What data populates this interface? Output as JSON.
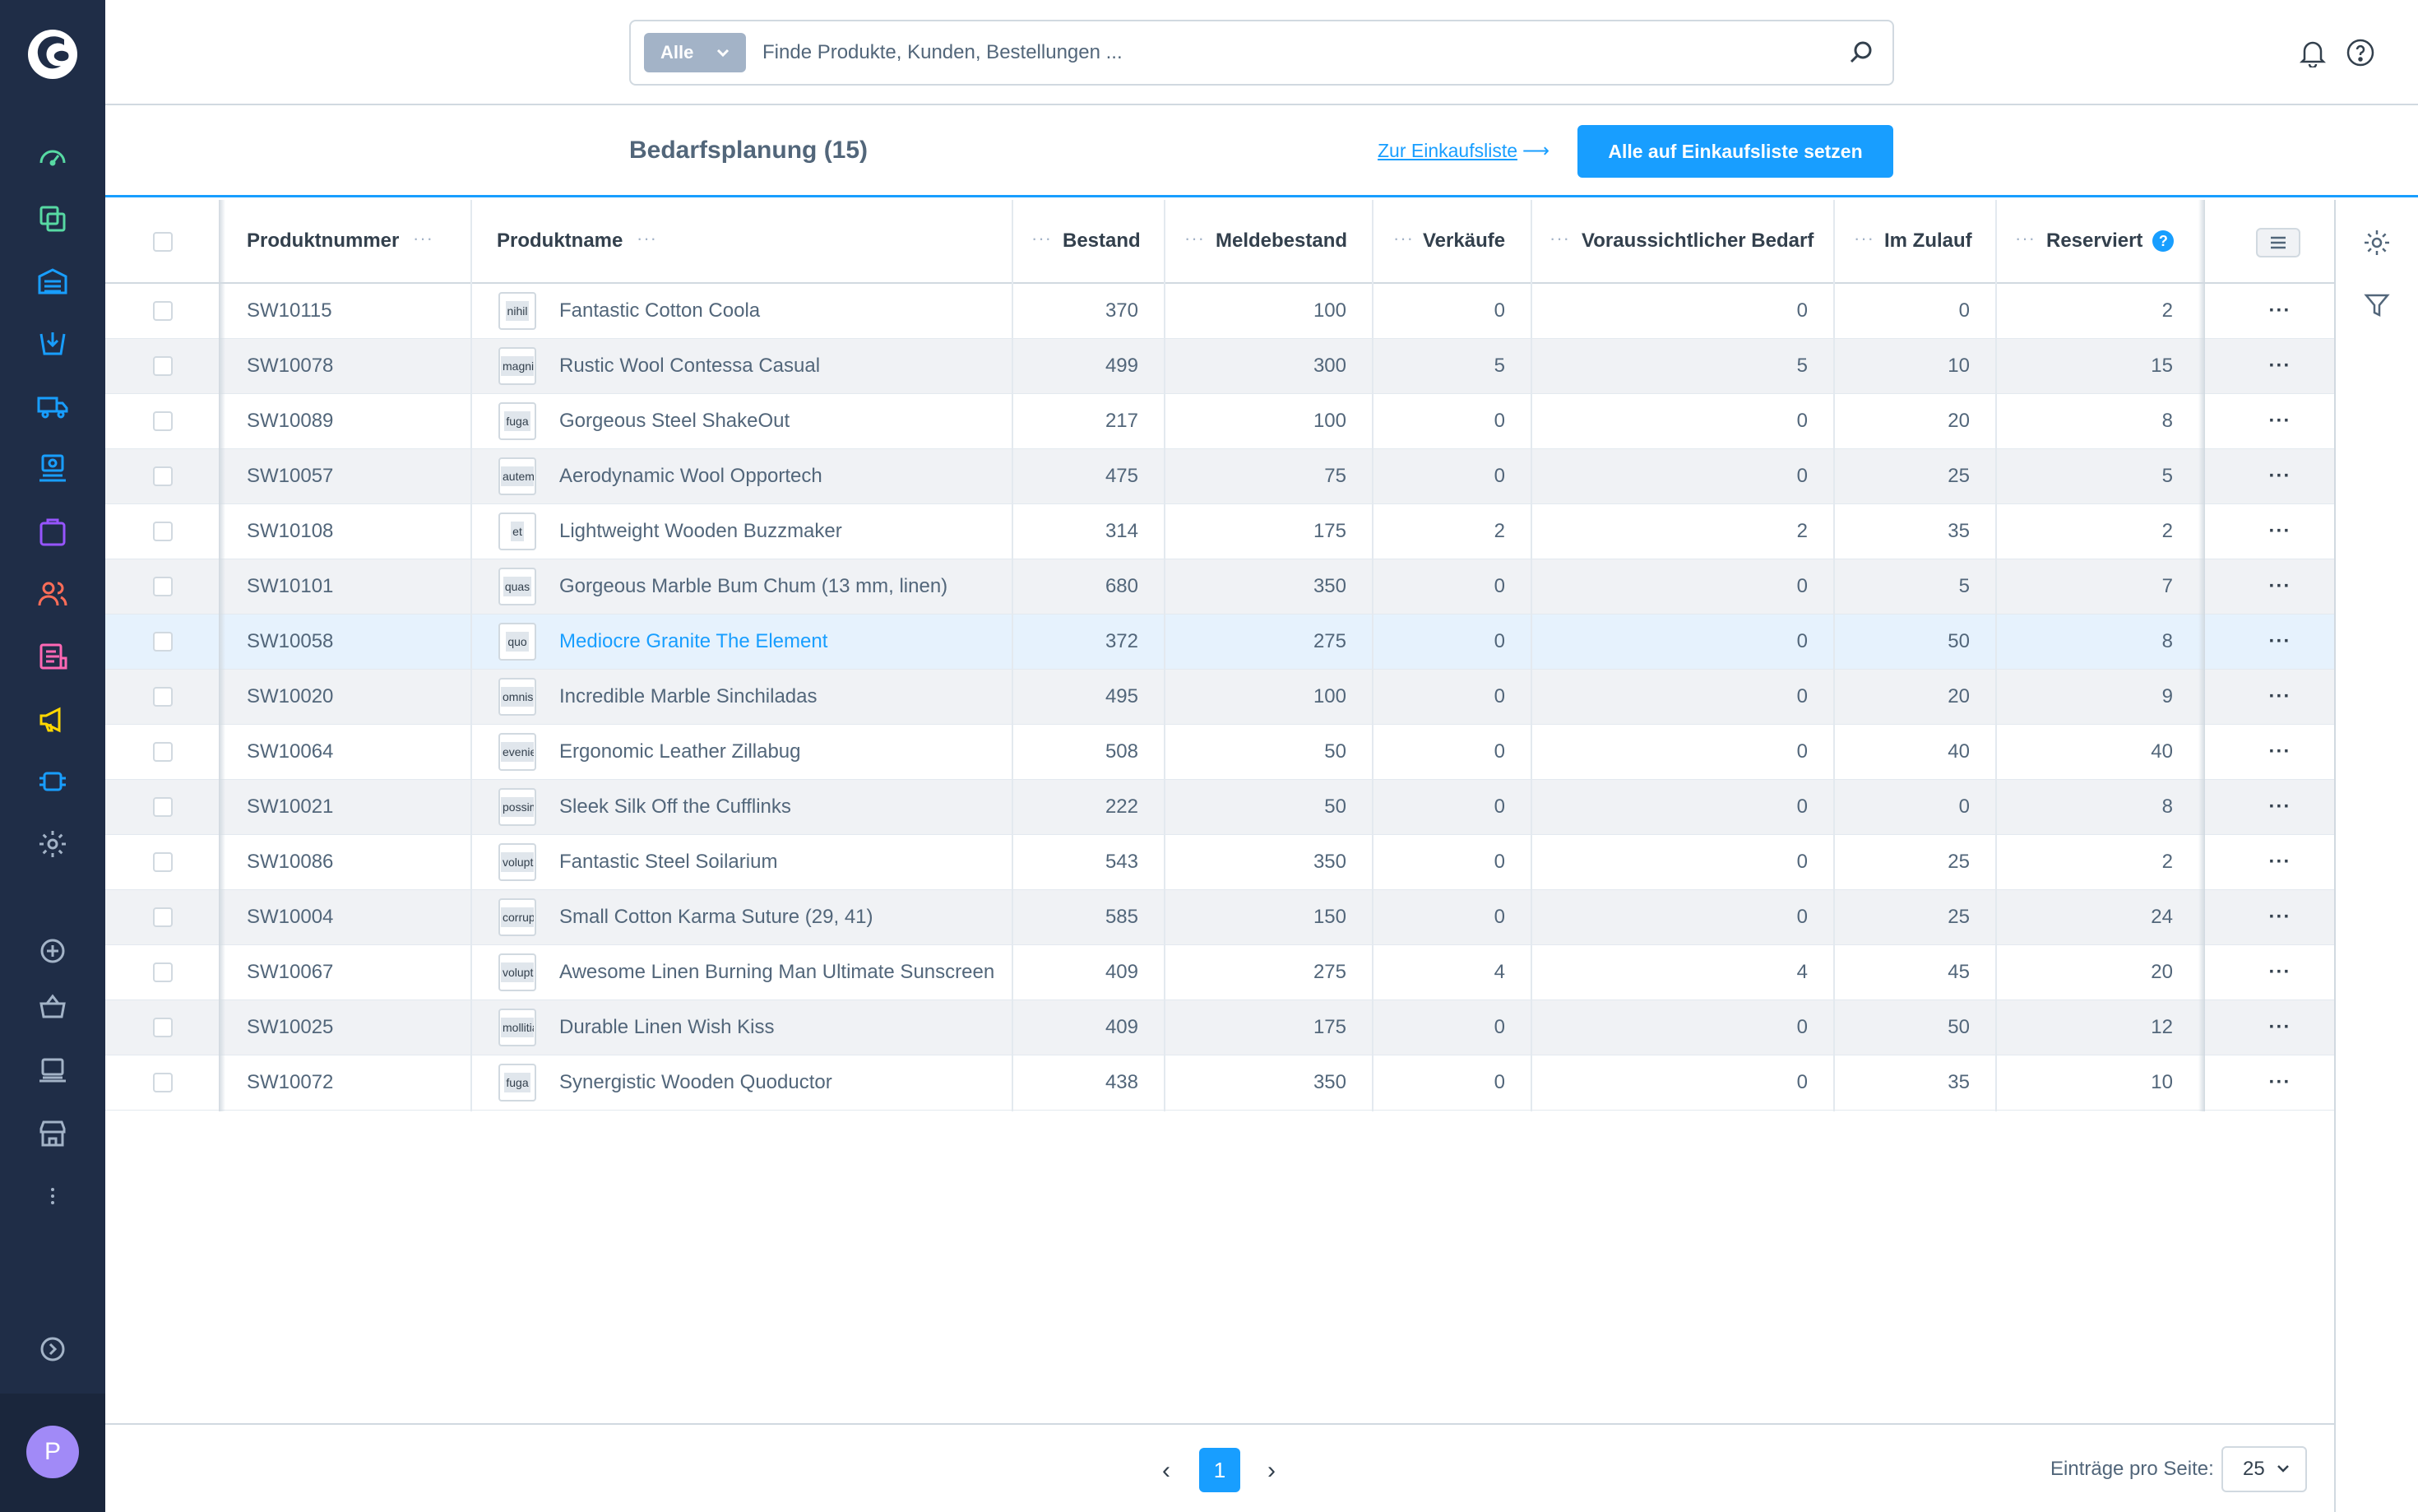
{
  "search": {
    "type_label": "Alle",
    "placeholder": "Finde Produkte, Kunden, Bestellungen ..."
  },
  "header": {
    "title": "Bedarfsplanung (15)",
    "link_label": "Zur Einkaufsliste",
    "primary_label": "Alle auf Einkaufsliste setzen"
  },
  "sidebar": {
    "avatar_initial": "P",
    "icons": [
      "dashboard-icon",
      "catalog-icon",
      "inventory-icon",
      "purchase-icon",
      "shipping-icon",
      "supplier-icon",
      "orders-icon",
      "customers-icon",
      "content-icon",
      "marketing-icon",
      "extensions-icon",
      "settings-icon",
      "add-icon",
      "basket-icon",
      "pos-icon",
      "store-icon",
      "more-icon",
      "expand-icon"
    ],
    "colors": {
      "bg": "#1f2d47",
      "teal": "#57d9a3",
      "blue": "#189eff",
      "red": "#ff6d58",
      "pink": "#ff68b4",
      "yellow": "#ffd700",
      "purple": "#9755ff",
      "avatar": "#a18af7"
    }
  },
  "table": {
    "columns": {
      "number": "Produktnummer",
      "name": "Produktname",
      "stock": "Bestand",
      "min_stock": "Meldebestand",
      "sales": "Verkäufe",
      "expected": "Voraussichtlicher Bedarf",
      "incoming": "Im Zulauf",
      "reserved": "Reserviert",
      "reserved_help": "?"
    },
    "rows": [
      {
        "number": "SW10115",
        "thumb": "nihil",
        "name": "Fantastic Cotton Coola",
        "stock": "370",
        "min_stock": "100",
        "sales": "0",
        "expected": "0",
        "incoming": "0",
        "reserved": "2"
      },
      {
        "number": "SW10078",
        "thumb": "magni",
        "name": "Rustic Wool Contessa Casual",
        "stock": "499",
        "min_stock": "300",
        "sales": "5",
        "expected": "5",
        "incoming": "10",
        "reserved": "15"
      },
      {
        "number": "SW10089",
        "thumb": "fuga",
        "name": "Gorgeous Steel ShakeOut",
        "stock": "217",
        "min_stock": "100",
        "sales": "0",
        "expected": "0",
        "incoming": "20",
        "reserved": "8"
      },
      {
        "number": "SW10057",
        "thumb": "autem",
        "name": "Aerodynamic Wool Opportech",
        "stock": "475",
        "min_stock": "75",
        "sales": "0",
        "expected": "0",
        "incoming": "25",
        "reserved": "5"
      },
      {
        "number": "SW10108",
        "thumb": "et",
        "name": "Lightweight Wooden Buzzmaker",
        "stock": "314",
        "min_stock": "175",
        "sales": "2",
        "expected": "2",
        "incoming": "35",
        "reserved": "2"
      },
      {
        "number": "SW10101",
        "thumb": "quas",
        "name": "Gorgeous Marble Bum Chum (13 mm, linen)",
        "stock": "680",
        "min_stock": "350",
        "sales": "0",
        "expected": "0",
        "incoming": "5",
        "reserved": "7"
      },
      {
        "number": "SW10058",
        "thumb": "quo",
        "name": "Mediocre Granite The Element",
        "stock": "372",
        "min_stock": "275",
        "sales": "0",
        "expected": "0",
        "incoming": "50",
        "reserved": "8"
      },
      {
        "number": "SW10020",
        "thumb": "omnis",
        "name": "Incredible Marble Sinchiladas",
        "stock": "495",
        "min_stock": "100",
        "sales": "0",
        "expected": "0",
        "incoming": "20",
        "reserved": "9"
      },
      {
        "number": "SW10064",
        "thumb": "eveniet",
        "name": "Ergonomic Leather Zillabug",
        "stock": "508",
        "min_stock": "50",
        "sales": "0",
        "expected": "0",
        "incoming": "40",
        "reserved": "40"
      },
      {
        "number": "SW10021",
        "thumb": "possimus",
        "name": "Sleek Silk Off the Cufflinks",
        "stock": "222",
        "min_stock": "50",
        "sales": "0",
        "expected": "0",
        "incoming": "0",
        "reserved": "8"
      },
      {
        "number": "SW10086",
        "thumb": "voluptates",
        "name": "Fantastic Steel Soilarium",
        "stock": "543",
        "min_stock": "350",
        "sales": "0",
        "expected": "0",
        "incoming": "25",
        "reserved": "2"
      },
      {
        "number": "SW10004",
        "thumb": "corrupti",
        "name": "Small Cotton Karma Suture (29, 41)",
        "stock": "585",
        "min_stock": "150",
        "sales": "0",
        "expected": "0",
        "incoming": "25",
        "reserved": "24"
      },
      {
        "number": "SW10067",
        "thumb": "voluptatum",
        "name": "Awesome Linen Burning Man Ultimate Sunscreen",
        "stock": "409",
        "min_stock": "275",
        "sales": "4",
        "expected": "4",
        "incoming": "45",
        "reserved": "20"
      },
      {
        "number": "SW10025",
        "thumb": "mollitia",
        "name": "Durable Linen Wish Kiss",
        "stock": "409",
        "min_stock": "175",
        "sales": "0",
        "expected": "0",
        "incoming": "50",
        "reserved": "12"
      },
      {
        "number": "SW10072",
        "thumb": "fuga",
        "name": "Synergistic Wooden Quoductor",
        "stock": "438",
        "min_stock": "350",
        "sales": "0",
        "expected": "0",
        "incoming": "35",
        "reserved": "10"
      }
    ]
  },
  "footer": {
    "page": "1",
    "per_page_label": "Einträge pro Seite:",
    "per_page_value": "25"
  }
}
